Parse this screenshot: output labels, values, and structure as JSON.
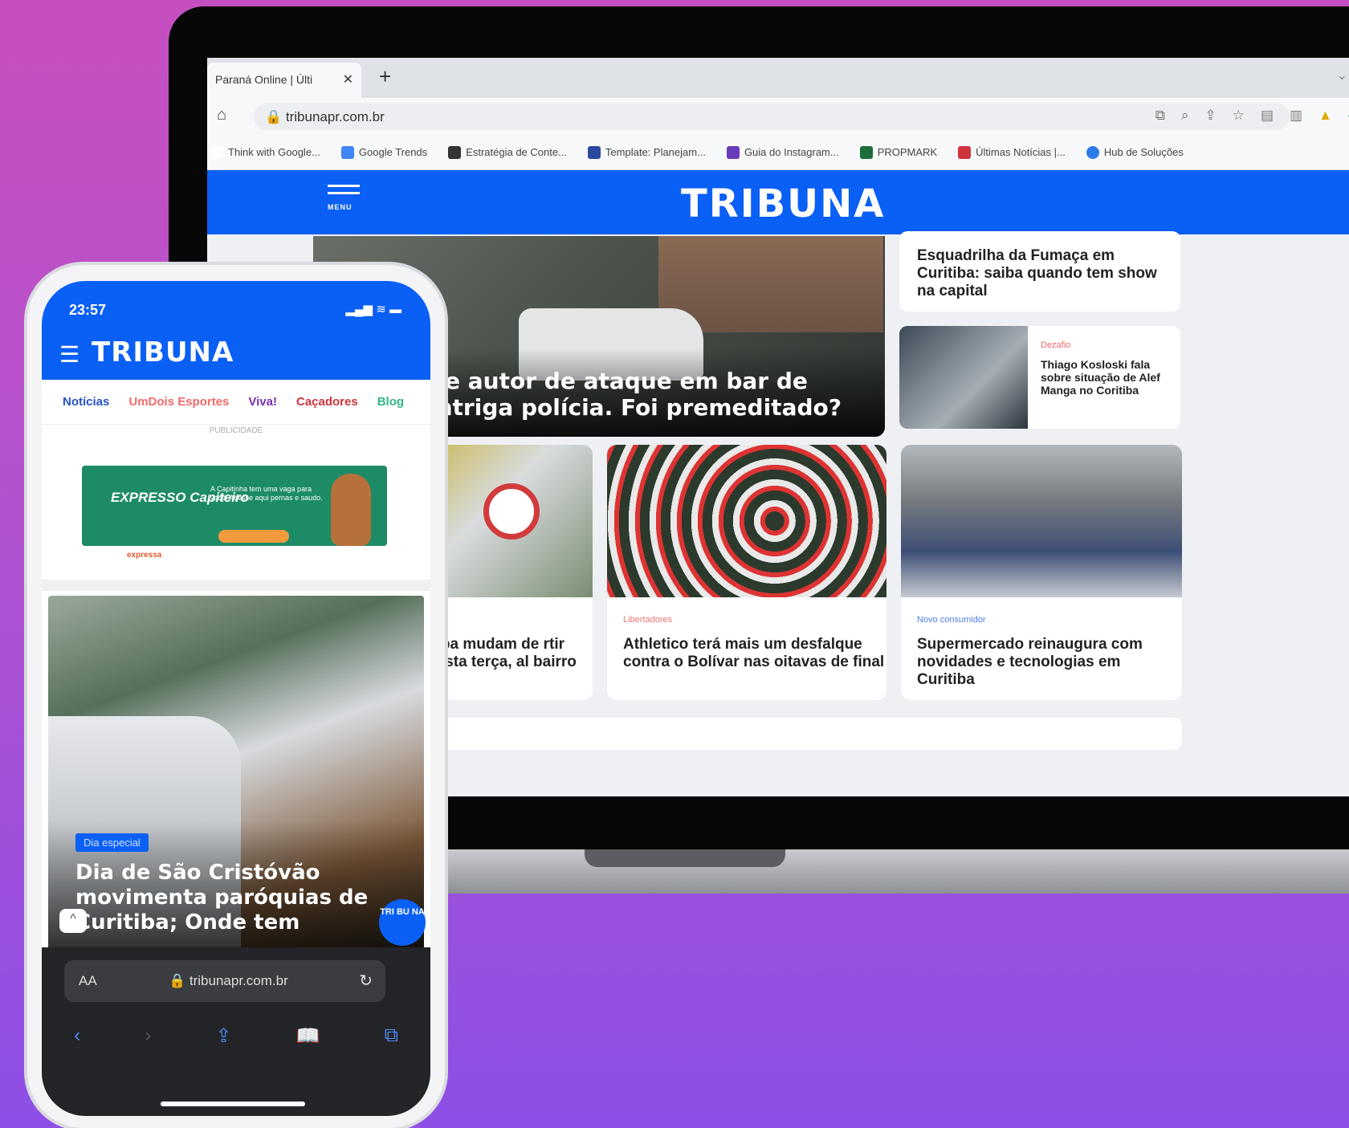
{
  "browser": {
    "tab_title": "Paraná Online | Últi",
    "tab_close": "✕",
    "new_tab": "+",
    "url": "tribunapr.com.br",
    "bookmarks": [
      {
        "label": "Think with Google...",
        "color": "#ffffff"
      },
      {
        "label": "Google Trends",
        "color": "#4285f4"
      },
      {
        "label": "Estratégia de Conte...",
        "color": "#333333"
      },
      {
        "label": "Template: Planejam...",
        "color": "#2a4aa0"
      },
      {
        "label": "Guia do Instagram...",
        "color": "#6a3bb8"
      },
      {
        "label": "PROPMARK",
        "color": "#1b6e3a"
      },
      {
        "label": "Últimas Notícias |...",
        "color": "#d0343d"
      },
      {
        "label": "Hub de Soluções",
        "color": "#2d7be8"
      }
    ]
  },
  "site": {
    "logo": "TRIBUNA",
    "menu_label": "MENU",
    "brand_color": "#0a5ff5"
  },
  "desktop": {
    "hero_title": "de autor de ataque em bar de intriga polícia. Foi premeditado?",
    "side_cards": [
      {
        "kicker": "",
        "title": "Esquadrilha da Fumaça em Curitiba: saiba quando tem show na capital"
      },
      {
        "kicker": "Dezafio",
        "title": "Thiago Kosloski fala sobre situação de Alef Manga no Coritiba"
      }
    ],
    "row_cards": [
      {
        "kicker": "",
        "title": "itiba mudam de rtir desta terça, al bairro"
      },
      {
        "kicker": "Libertadores",
        "title": "Athletico terá mais um desfalque contra o Bolívar nas oitavas de final"
      },
      {
        "kicker": "Novo consumidor",
        "title": "Supermercado reinaugura com novidades e tecnologias em Curitiba"
      }
    ]
  },
  "mobile": {
    "time": "23:57",
    "status_icons": "▂▄▆ ≋ ▬",
    "menu_icon": "☰",
    "logo": "TRIBUNA",
    "nav": [
      "Notícias",
      "UmDois Esportes",
      "Viva!",
      "Caçadores",
      "Blog"
    ],
    "ad_label": "PUBLICIDADE",
    "ad": {
      "title": "EXPRESSO Capiteiro",
      "text": "A Capitinha tem uma vaga para você! Acesse aqui pernas e saudo.",
      "brand": "expressa"
    },
    "story_tag": "Dia especial",
    "story_title": "Dia de São Cristóvão movimenta paróquias de Curitiba; Onde tem",
    "fab": "TRI BU NA",
    "up_icon": "^",
    "browser_aa": "AA",
    "browser_url": "🔒 tribunapr.com.br",
    "reload_icon": "↻",
    "toolbar": [
      "‹",
      "›",
      "⇪",
      "📖",
      "⧉"
    ]
  }
}
